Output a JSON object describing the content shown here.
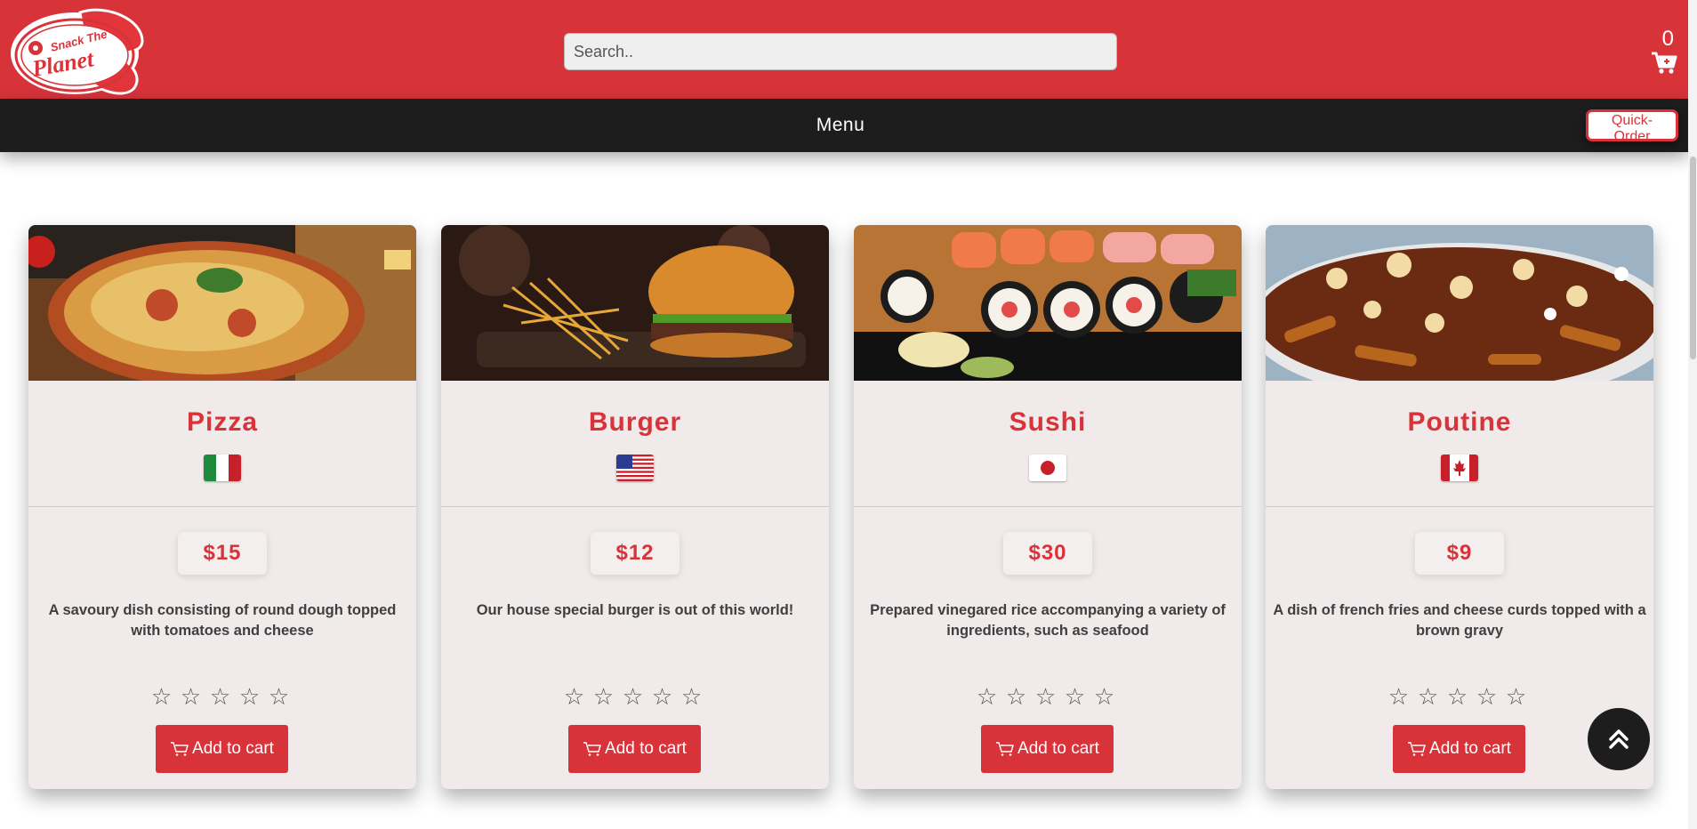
{
  "header": {
    "logo_text_line1": "Snack The",
    "logo_text_line2": "Planet",
    "search_placeholder": "Search..",
    "cart_count": "0",
    "brand_color": "#d9333a"
  },
  "nav": {
    "menu_label": "Menu",
    "quick_order_label": "Quick-Order"
  },
  "products": [
    {
      "name": "Pizza",
      "flag": "italy-flag",
      "price": "$15",
      "description": "A savoury dish consisting of round dough topped with tomatoes and cheese",
      "rating": 0,
      "button_label": "Add to cart"
    },
    {
      "name": "Burger",
      "flag": "usa-flag",
      "price": "$12",
      "description": "Our house special burger is out of this world!",
      "rating": 0,
      "button_label": "Add to cart"
    },
    {
      "name": "Sushi",
      "flag": "japan-flag",
      "price": "$30",
      "description": "Prepared vinegared rice accompanying a variety of ingredients, such as seafood",
      "rating": 0,
      "button_label": "Add to cart"
    },
    {
      "name": "Poutine",
      "flag": "canada-flag",
      "price": "$9",
      "description": "A dish of french fries and cheese curds topped with a brown gravy",
      "rating": 0,
      "button_label": "Add to cart"
    }
  ],
  "icons": {
    "cart": "cart-icon",
    "back_to_top": "double-chevron-up-icon",
    "star": "star-outline-icon"
  }
}
